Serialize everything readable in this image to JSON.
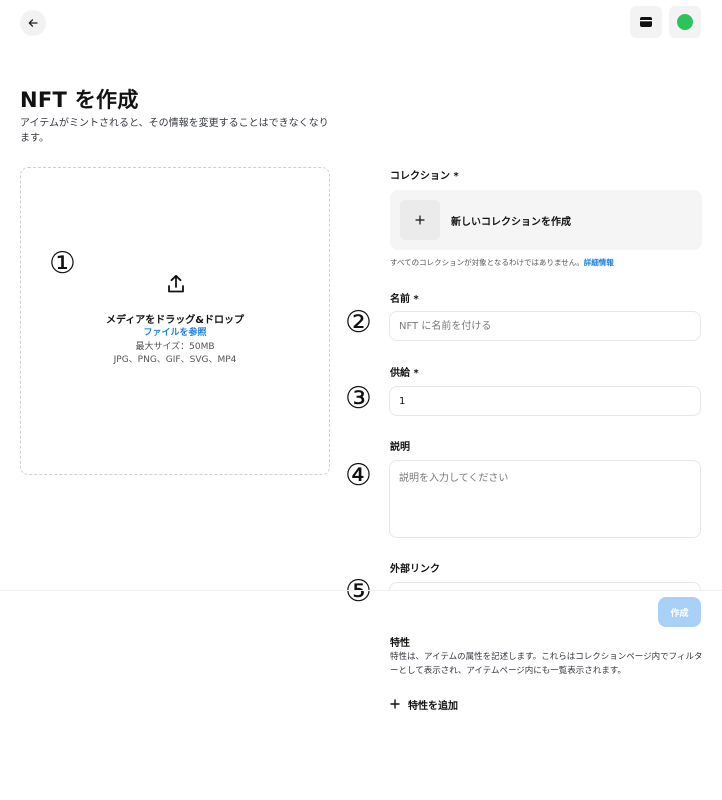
{
  "header": {
    "back_icon": "arrow-left-icon",
    "wallet_icon": "wallet-icon",
    "profile_color": "#2cc45a"
  },
  "page": {
    "title": "NFT を作成",
    "subtitle": "アイテムがミントされると、その情報を変更することはできなくなります。"
  },
  "upload": {
    "icon": "upload-icon",
    "title": "メディアをドラッグ&ドロップ",
    "browse_link": "ファイルを参照",
    "max_size": "最大サイズ：50MB",
    "file_types": "JPG、PNG、GIF、SVG、MP4"
  },
  "markers": [
    "①",
    "②",
    "③",
    "④",
    "⑤"
  ],
  "form": {
    "collection": {
      "label": "コレクション *",
      "create_label": "新しいコレクションを作成",
      "plus_icon": "plus-icon",
      "helper_text": "すべてのコレクションが対象となるわけではありません。",
      "helper_link": "詳細情報"
    },
    "name": {
      "label": "名前 *",
      "placeholder": "NFT に名前を付ける",
      "value": ""
    },
    "supply": {
      "label": "供給 *",
      "value": "1"
    },
    "description": {
      "label": "説明",
      "placeholder": "説明を入力してください",
      "value": ""
    },
    "external_link": {
      "label": "外部リンク"
    },
    "create_button": "作成",
    "accent_color": "#2081e2",
    "disabled_button_color": "#a9d0f7"
  },
  "traits": {
    "title": "特性",
    "description": "特性は、アイテムの属性を記述します。これらはコレクションページ内でフィルターとして表示され、アイテムページ内にも一覧表示されます。",
    "add_icon": "plus-icon",
    "add_label": "特性を追加"
  }
}
